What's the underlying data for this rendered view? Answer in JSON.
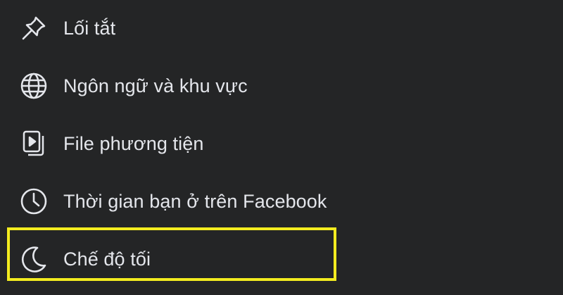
{
  "menu": {
    "items": [
      {
        "label": "Lối tắt",
        "icon": "pin-icon"
      },
      {
        "label": "Ngôn ngữ và khu vực",
        "icon": "globe-icon"
      },
      {
        "label": "File phương tiện",
        "icon": "media-file-icon"
      },
      {
        "label": "Thời gian bạn ở trên Facebook",
        "icon": "clock-icon"
      },
      {
        "label": "Chế độ tối",
        "icon": "moon-icon"
      }
    ]
  },
  "highlight": {
    "target": "Chế độ tối",
    "color": "#f3ec1f"
  },
  "colors": {
    "background": "#242526",
    "text": "#e4e6eb"
  }
}
